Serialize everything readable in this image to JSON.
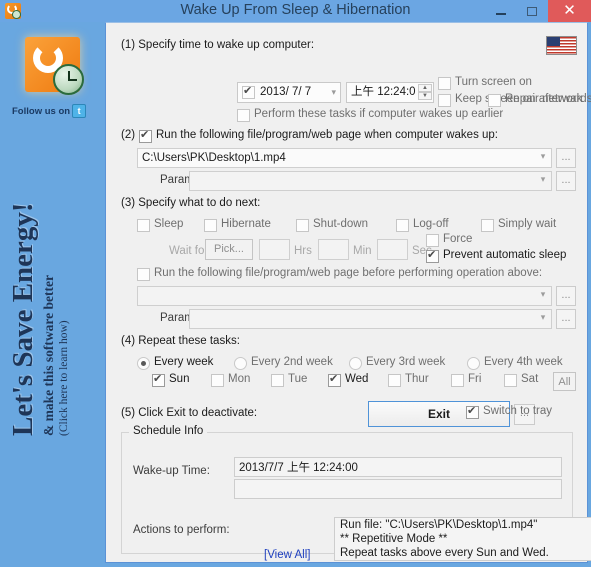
{
  "window": {
    "title": "Wake Up From Sleep & Hibernation",
    "minimize_label": "–",
    "maximize_label": "□",
    "close_label": "✕",
    "app_icon": "clock-power-icon"
  },
  "sidebar": {
    "logo_icon": "wakeup-clock-logo",
    "follow_label": "Follow us on",
    "twitter_icon": "twitter-icon",
    "twitter_glyph": "t",
    "promo_line1": "Let's Save Energy!",
    "promo_line2": "& make this software better",
    "promo_line3": "(Click here to learn how)"
  },
  "section1": {
    "heading": "(1) Specify time to wake up computer:",
    "date_checked": true,
    "date_value": "2013/ 7/ 7",
    "time_value": "上午 12:24:0",
    "turn_screen_on": {
      "label": "Turn screen on",
      "checked": false
    },
    "keep_screen_on": {
      "label": "Keep screen on afterwards",
      "checked": false
    },
    "repair_network": {
      "label": "Repair network",
      "checked": false
    },
    "perform_earlier": {
      "label": "Perform these tasks if computer wakes up earlier",
      "checked": false
    },
    "flag_icon": "us-flag-icon"
  },
  "section2": {
    "heading": "(2)",
    "run_label": "Run the following file/program/web page when computer wakes up:",
    "run_checked": true,
    "file_value": "C:\\Users\\PK\\Desktop\\1.mp4",
    "params_label": "Params:",
    "params_value": "",
    "browse_label": "...",
    "dropdown_icon": "chevron-down-icon"
  },
  "section3": {
    "heading": "(3) Specify what to do next:",
    "options": [
      {
        "label": "Sleep",
        "checked": false
      },
      {
        "label": "Hibernate",
        "checked": false
      },
      {
        "label": "Shut-down",
        "checked": false
      },
      {
        "label": "Log-off",
        "checked": false
      },
      {
        "label": "Simply wait",
        "checked": false
      }
    ],
    "wait_for_label": "Wait for:",
    "pick_label": "Pick...",
    "hrs_value": "",
    "hrs_label": "Hrs",
    "min_value": "",
    "min_label": "Min",
    "sec_value": "",
    "sec_label": "Sec",
    "force": {
      "label": "Force",
      "checked": false
    },
    "prevent_sleep": {
      "label": "Prevent automatic sleep",
      "checked": true
    },
    "run_before_label": "Run the following file/program/web page before performing operation above:",
    "run_before_checked": false,
    "file_value": "",
    "params_label": "Params:",
    "params_value": "",
    "browse_label": "..."
  },
  "section4": {
    "heading": "(4) Repeat these tasks:",
    "week_options": [
      {
        "label": "Every week",
        "selected": true
      },
      {
        "label": "Every 2nd week",
        "selected": false
      },
      {
        "label": "Every 3rd week",
        "selected": false
      },
      {
        "label": "Every 4th week",
        "selected": false
      }
    ],
    "days": [
      {
        "label": "Sun",
        "checked": true
      },
      {
        "label": "Mon",
        "checked": false
      },
      {
        "label": "Tue",
        "checked": false
      },
      {
        "label": "Wed",
        "checked": true
      },
      {
        "label": "Thur",
        "checked": false
      },
      {
        "label": "Fri",
        "checked": false
      },
      {
        "label": "Sat",
        "checked": false
      }
    ],
    "all_label": "All"
  },
  "section5": {
    "heading": "(5) Click Exit to deactivate:",
    "exit_label": "Exit",
    "browse_label": "...",
    "switch_to_tray": {
      "label": "Switch to tray",
      "checked": true
    }
  },
  "schedule_info": {
    "legend": "Schedule Info",
    "wakeup_label": "Wake-up Time:",
    "wakeup_value": "2013/7/7 上午 12:24:00",
    "second_value": "",
    "actions_label": "Actions to perform:",
    "view_all_label": "[View All]",
    "action_lines": [
      "Run file: \"C:\\Users\\PK\\Desktop\\1.mp4\"",
      "** Repetitive Mode **",
      "Repeat tasks above every Sun and Wed."
    ],
    "scroll_up_icon": "chevron-up-icon",
    "scroll_down_icon": "chevron-down-icon"
  },
  "colors": {
    "desktop_blue": "#69a7e0",
    "titlebar_blue": "#6ba6e3",
    "panel_gray": "#f0f0f0",
    "panel_border": "#5b92d6",
    "close_red": "#e05a5a",
    "link_blue": "#1e3fbf"
  }
}
